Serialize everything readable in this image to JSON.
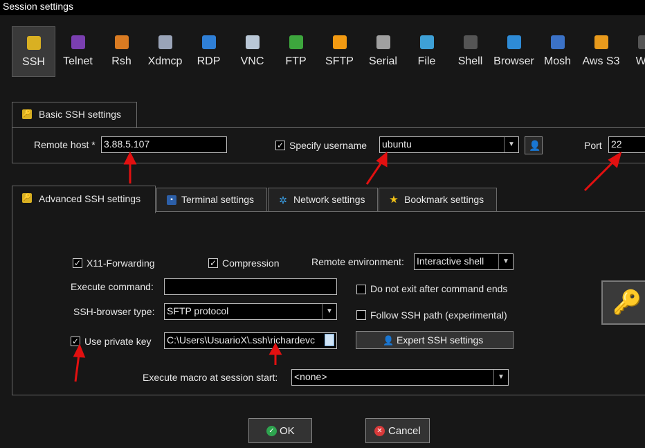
{
  "window": {
    "title": "Session settings"
  },
  "session_types": [
    {
      "label": "SSH",
      "icon": "key-icon",
      "color": "#d9b022"
    },
    {
      "label": "Telnet",
      "icon": "telnet-icon",
      "color": "#7a3fb0"
    },
    {
      "label": "Rsh",
      "icon": "rsh-icon",
      "color": "#d97b22"
    },
    {
      "label": "Xdmcp",
      "icon": "xdmcp-icon",
      "color": "#9aa4b8"
    },
    {
      "label": "RDP",
      "icon": "rdp-icon",
      "color": "#2f7fd6"
    },
    {
      "label": "VNC",
      "icon": "vnc-icon",
      "color": "#b9c7d6"
    },
    {
      "label": "FTP",
      "icon": "ftp-icon",
      "color": "#3da63d"
    },
    {
      "label": "SFTP",
      "icon": "sftp-icon",
      "color": "#f29a12"
    },
    {
      "label": "Serial",
      "icon": "serial-icon",
      "color": "#a0a0a0"
    },
    {
      "label": "File",
      "icon": "file-icon",
      "color": "#3ea0d6"
    },
    {
      "label": "Shell",
      "icon": "shell-icon",
      "color": "#555555"
    },
    {
      "label": "Browser",
      "icon": "browser-icon",
      "color": "#2e8bd6"
    },
    {
      "label": "Mosh",
      "icon": "mosh-icon",
      "color": "#3b72c7"
    },
    {
      "label": "Aws S3",
      "icon": "aws-icon",
      "color": "#e89a1c"
    },
    {
      "label": "WS",
      "icon": "ws-icon",
      "color": "#555555"
    }
  ],
  "basic": {
    "tab_label": "Basic SSH settings",
    "remote_host_label": "Remote host *",
    "remote_host_value": "3.88.5.107",
    "specify_username_label": "Specify username",
    "specify_username_checked": "✓",
    "username_value": "ubuntu",
    "port_label": "Port",
    "port_value": "22"
  },
  "tabs": [
    {
      "label": "Advanced SSH settings"
    },
    {
      "label": "Terminal settings"
    },
    {
      "label": "Network settings"
    },
    {
      "label": "Bookmark settings"
    }
  ],
  "advanced": {
    "x11_label": "X11-Forwarding",
    "x11_checked": "✓",
    "compression_label": "Compression",
    "compression_checked": "✓",
    "remote_env_label": "Remote environment:",
    "remote_env_value": "Interactive shell",
    "exec_cmd_label": "Execute command:",
    "exec_cmd_value": "",
    "do_not_exit_label": "Do not exit after command ends",
    "browser_type_label": "SSH-browser type:",
    "browser_type_value": "SFTP protocol",
    "follow_path_label": "Follow SSH path (experimental)",
    "private_key_label": "Use private key",
    "private_key_checked": "✓",
    "private_key_value": "C:\\Users\\UsuarioX\\.ssh\\richardevc",
    "expert_label": "Expert SSH settings",
    "macro_label": "Execute macro at session start:",
    "macro_value": "<none>"
  },
  "buttons": {
    "ok": "OK",
    "cancel": "Cancel"
  },
  "colors": {
    "annotation_arrow": "#e21010",
    "ok_icon": "#2ea44f",
    "cancel_icon": "#d93a3a"
  }
}
